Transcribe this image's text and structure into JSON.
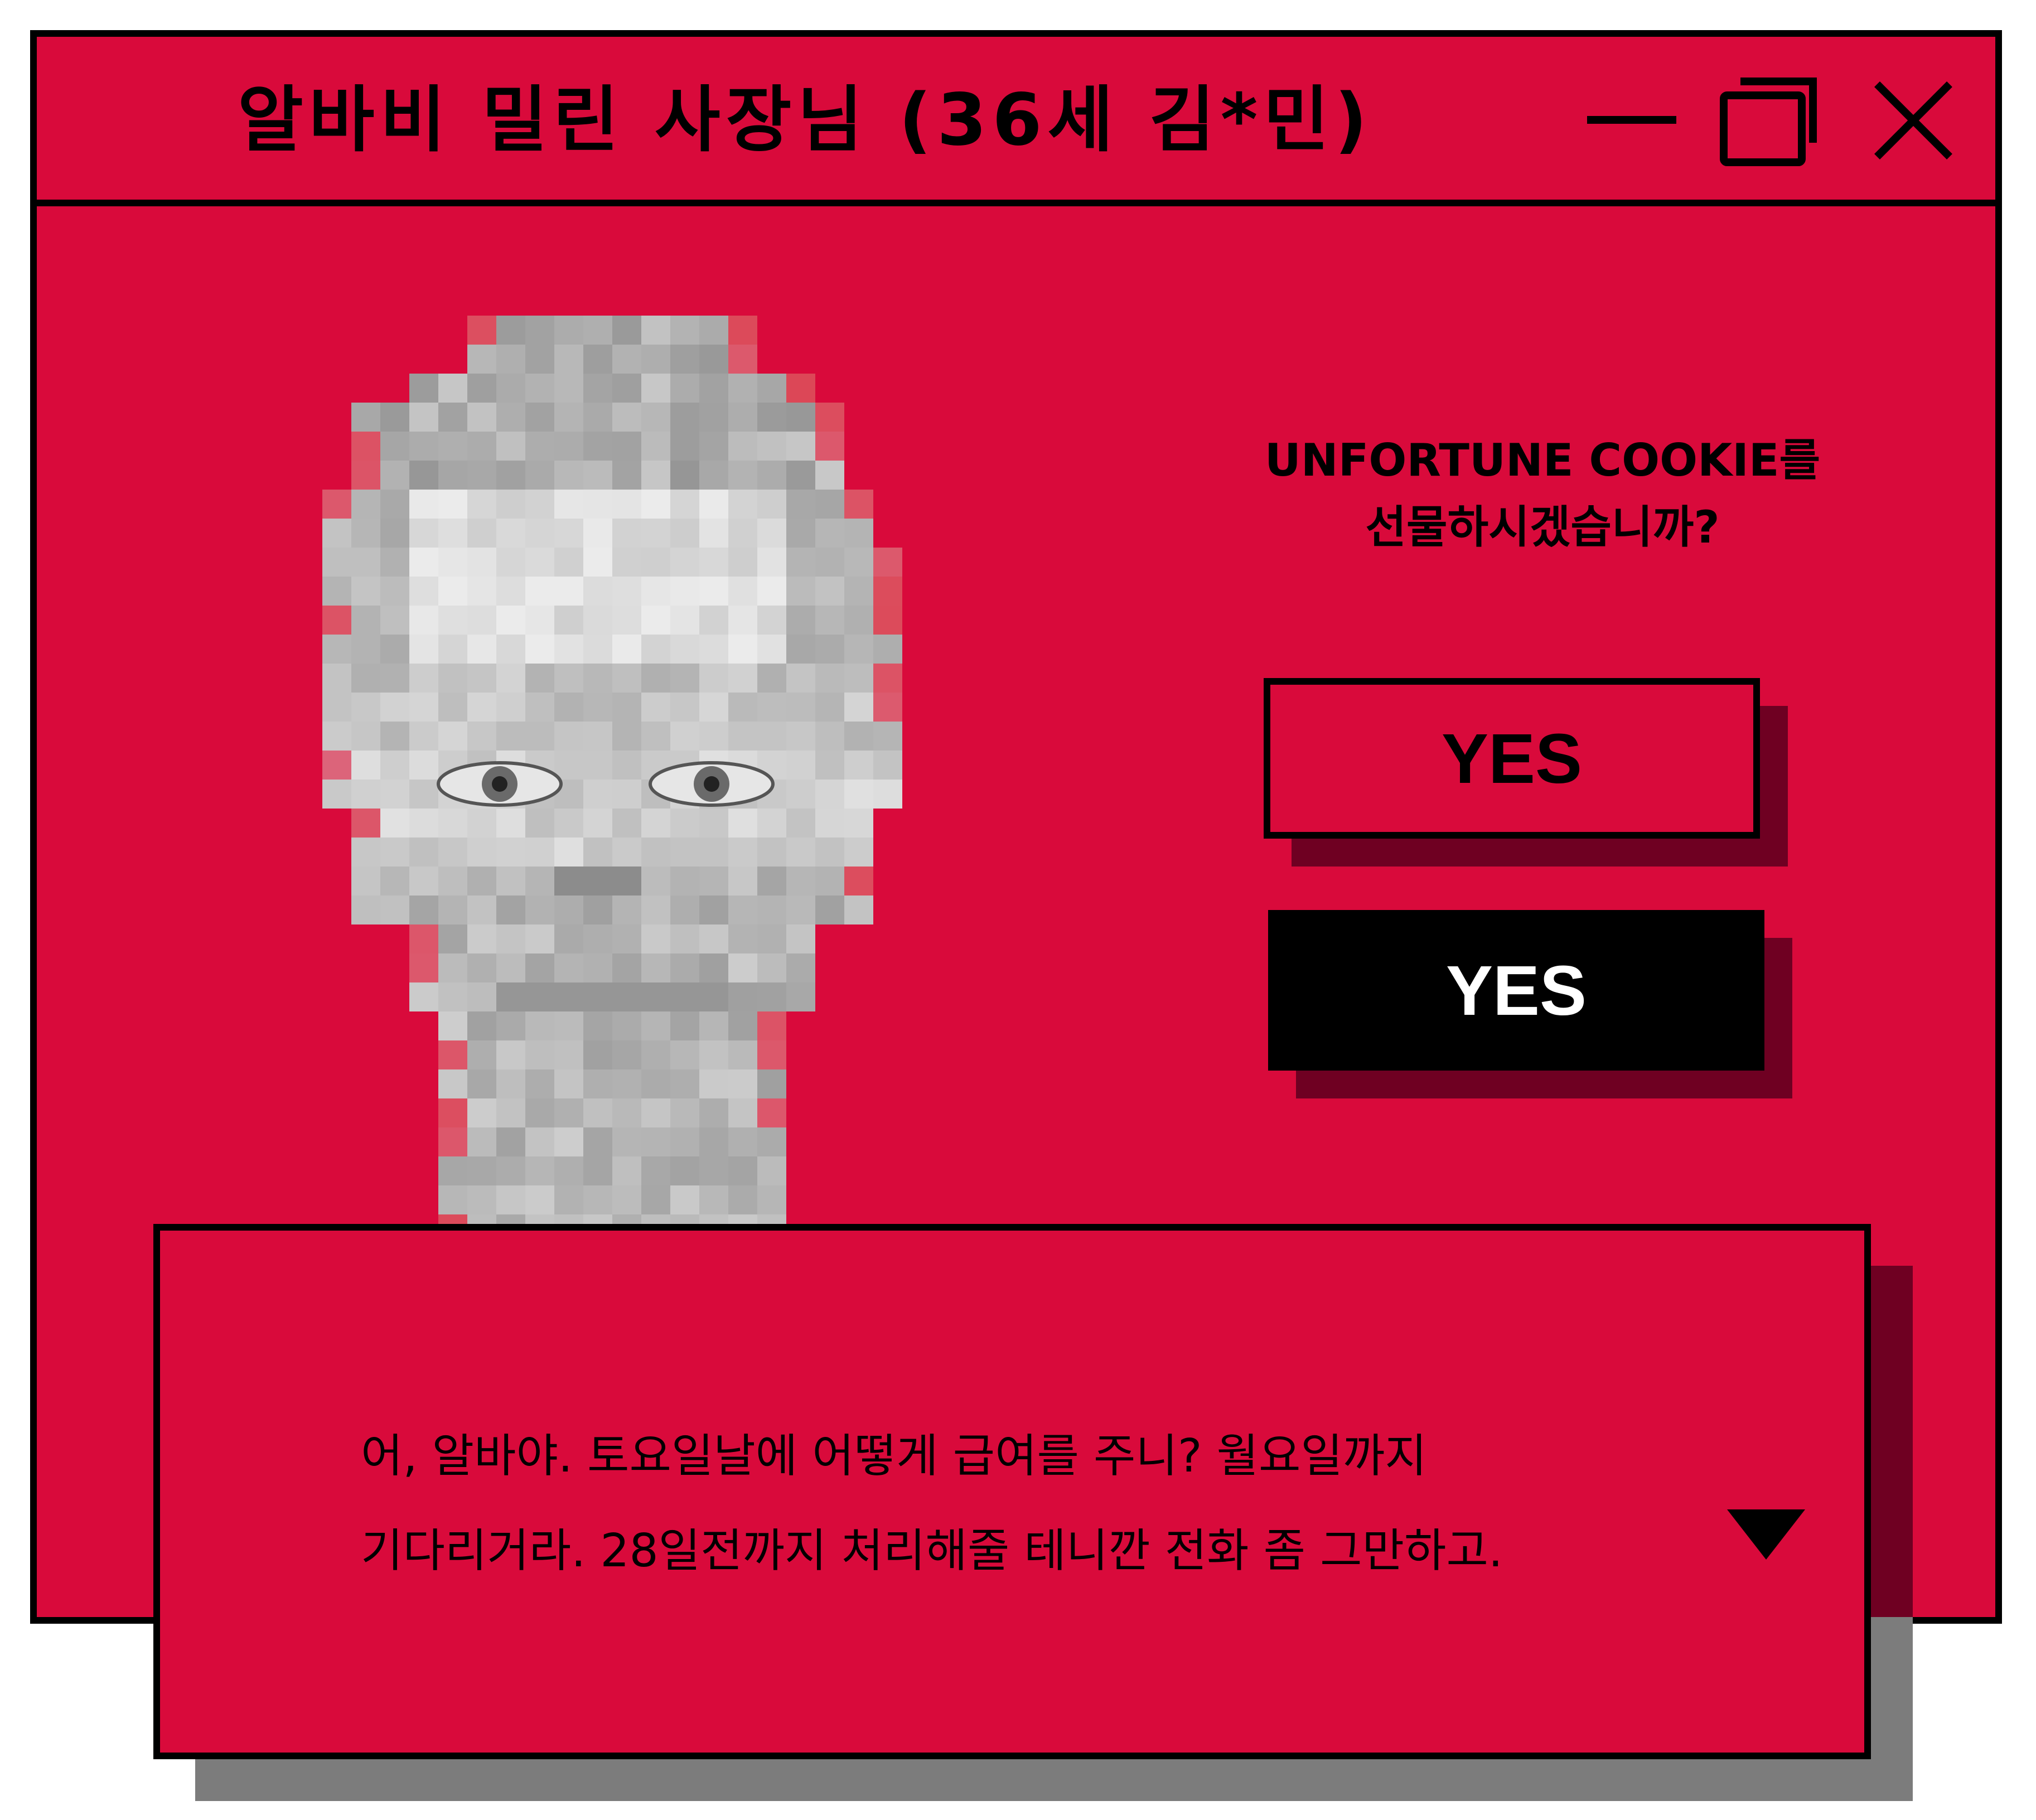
{
  "window": {
    "title": "알바비 밀린 사장님 (36세 김*민)",
    "controls": [
      "minimize-icon",
      "maximize-icon",
      "close-icon"
    ]
  },
  "colors": {
    "window_background": "#d90a3b",
    "border": "#000000",
    "button_shadow": "#6f0022",
    "dialog_shadow": "#7c7c7c",
    "solid_button_text": "#ffffff"
  },
  "prompt": {
    "line1": "UNFORTUNE COOKIE를",
    "line2": "선물하시겠습니까?"
  },
  "buttons": {
    "yes_outline_label": "YES",
    "yes_solid_label": "YES"
  },
  "dialog": {
    "line1": "어, 알바야. 토요일날에 어떻게 급여를 주니? 월요일까지",
    "line2": "기다리거라. 28일전까지 처리해줄 테니깐 전화 좀 그만하고.",
    "next_icon": "triangle-down-icon"
  },
  "portrait": {
    "description_icon": "pixelated-face-image"
  }
}
